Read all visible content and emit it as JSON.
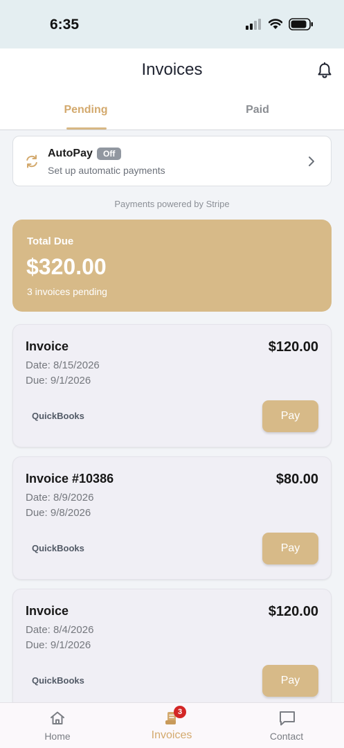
{
  "status_bar": {
    "time": "6:35"
  },
  "header": {
    "title": "Invoices"
  },
  "tabs": [
    {
      "label": "Pending",
      "active": true
    },
    {
      "label": "Paid",
      "active": false
    }
  ],
  "autopay": {
    "title": "AutoPay",
    "status": "Off",
    "subtitle": "Set up automatic payments"
  },
  "powered_by": "Payments powered by Stripe",
  "total": {
    "label": "Total Due",
    "amount": "$320.00",
    "subtitle": "3 invoices pending"
  },
  "invoices": [
    {
      "title": "Invoice",
      "amount": "$120.00",
      "date": "Date: 8/15/2026",
      "due": "Due: 9/1/2026",
      "source": "QuickBooks",
      "action": "Pay"
    },
    {
      "title": "Invoice #10386",
      "amount": "$80.00",
      "date": "Date: 8/9/2026",
      "due": "Due: 9/8/2026",
      "source": "QuickBooks",
      "action": "Pay"
    },
    {
      "title": "Invoice",
      "amount": "$120.00",
      "date": "Date: 8/4/2026",
      "due": "Due: 9/1/2026",
      "source": "QuickBooks",
      "action": "Pay"
    }
  ],
  "bottom_nav": [
    {
      "label": "Home",
      "icon": "home-icon"
    },
    {
      "label": "Invoices",
      "icon": "invoice-icon",
      "badge": "3",
      "active": true
    },
    {
      "label": "Contact",
      "icon": "chat-icon"
    }
  ],
  "colors": {
    "accent": "#d7ba88",
    "accent_text": "#d3a96d",
    "badge_red": "#d32626",
    "status_bar_bg": "#e4eef1"
  }
}
